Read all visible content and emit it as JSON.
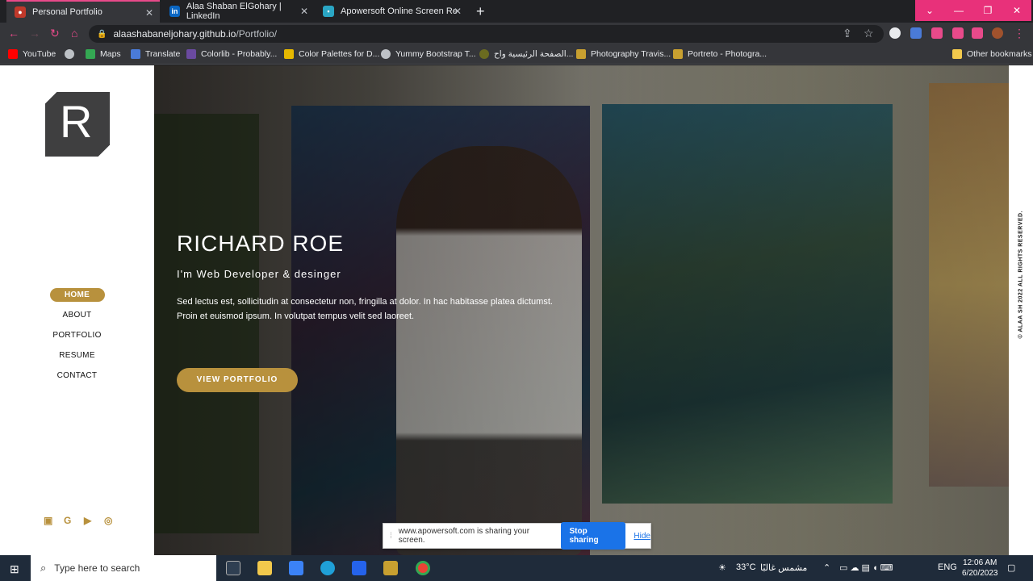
{
  "browser": {
    "tabs": [
      {
        "label": "Personal Portfolio",
        "active": true
      },
      {
        "label": "Alaa Shaban ElGohary | LinkedIn",
        "active": false
      },
      {
        "label": "Apowersoft Online Screen Re",
        "active": false
      }
    ],
    "url_host": "alaashabaneljohary.github.io",
    "url_path": "/Portfolio/",
    "bookmarks": [
      "YouTube",
      "Maps",
      "Translate",
      "Colorlib - Probably...",
      "Color Palettes for D...",
      "Yummy Bootstrap T...",
      "الصفحة الرئيسية واح...",
      "Photography Travis...",
      "Portreto - Photogra...",
      "Other bookmarks"
    ]
  },
  "sidebar": {
    "logo_letter": "R",
    "menu": [
      {
        "label": "HOME",
        "active": true
      },
      {
        "label": "ABOUT",
        "active": false
      },
      {
        "label": "PORTFOLIO",
        "active": false
      },
      {
        "label": "RESUME",
        "active": false
      },
      {
        "label": "CONTACT",
        "active": false
      }
    ],
    "social_icons": [
      "twitter-icon",
      "google-icon",
      "youtube-icon",
      "instagram-icon"
    ]
  },
  "hero": {
    "name": "RICHARD ROE",
    "subtitle": "I'm Web Developer & desinger",
    "text_line1": "Sed lectus est, sollicitudin at consectetur non, fringilla at dolor. In hac habitasse platea dictumst.",
    "text_line2": "Proin et euismod ipsum. In volutpat tempus velit sed laoreet.",
    "button_label": "VIEW PORTFOLIO"
  },
  "rights_text": "© ALAA SH 2022 ALL RIGHTS RESERVED.",
  "share_bar": {
    "message": "www.apowersoft.com is sharing your screen.",
    "stop_label": "Stop sharing",
    "hide_label": "Hide"
  },
  "taskbar": {
    "search_placeholder": "Type here to search",
    "weather": "33°C",
    "weather_text": "مشمس غالبًا",
    "language": "ENG",
    "time": "12:06 AM",
    "date": "6/20/2023"
  },
  "colors": {
    "accent": "#b8913d",
    "tab_accent": "#e84a8a"
  }
}
